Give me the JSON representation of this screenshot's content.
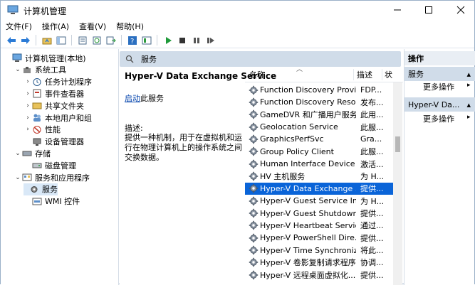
{
  "window": {
    "title": "计算机管理"
  },
  "menu": [
    "文件(F)",
    "操作(A)",
    "查看(V)",
    "帮助(H)"
  ],
  "tree": [
    {
      "label": "计算机管理(本地)",
      "level": 0,
      "icon": "computer-icon",
      "twisty": ""
    },
    {
      "label": "系统工具",
      "level": 1,
      "icon": "tools-icon",
      "twisty": "⌄"
    },
    {
      "label": "任务计划程序",
      "level": 2,
      "icon": "clock-icon",
      "twisty": "›"
    },
    {
      "label": "事件查看器",
      "level": 2,
      "icon": "event-viewer-icon",
      "twisty": "›"
    },
    {
      "label": "共享文件夹",
      "level": 2,
      "icon": "shared-folder-icon",
      "twisty": "›"
    },
    {
      "label": "本地用户和组",
      "level": 2,
      "icon": "users-icon",
      "twisty": "›"
    },
    {
      "label": "性能",
      "level": 2,
      "icon": "performance-icon",
      "twisty": "›"
    },
    {
      "label": "设备管理器",
      "level": 2,
      "icon": "device-manager-icon",
      "twisty": ""
    },
    {
      "label": "存储",
      "level": 1,
      "icon": "storage-icon",
      "twisty": "⌄"
    },
    {
      "label": "磁盘管理",
      "level": 2,
      "icon": "disk-icon",
      "twisty": ""
    },
    {
      "label": "服务和应用程序",
      "level": 1,
      "icon": "apps-icon",
      "twisty": "⌄"
    },
    {
      "label": "服务",
      "level": 2,
      "icon": "services-icon",
      "twisty": "",
      "selected": true
    },
    {
      "label": "WMI 控件",
      "level": 2,
      "icon": "wmi-icon",
      "twisty": ""
    }
  ],
  "middle": {
    "header": "服务",
    "selected_title": "Hyper-V Data Exchange Service",
    "start_link": "启动",
    "start_suffix": "此服务",
    "desc_label": "描述:",
    "desc_text": "提供一种机制，用于在虚拟机和运行在物理计算机上的操作系统之间交换数据。"
  },
  "list": {
    "col_name": "名称",
    "col_desc": "描述",
    "col_status": "状",
    "rows": [
      {
        "name": "Function Discovery Provi...",
        "desc": "FDP..."
      },
      {
        "name": "Function Discovery Reso...",
        "desc": "发布..."
      },
      {
        "name": "GameDVR 和广播用户服务...",
        "desc": "此用..."
      },
      {
        "name": "Geolocation Service",
        "desc": "此服..."
      },
      {
        "name": "GraphicsPerfSvc",
        "desc": "Gra..."
      },
      {
        "name": "Group Policy Client",
        "desc": "此服..."
      },
      {
        "name": "Human Interface Device ...",
        "desc": "激活..."
      },
      {
        "name": "HV 主机服务",
        "desc": "为 H..."
      },
      {
        "name": "Hyper-V Data Exchange ...",
        "desc": "提供...",
        "selected": true
      },
      {
        "name": "Hyper-V Guest Service In...",
        "desc": "为 H..."
      },
      {
        "name": "Hyper-V Guest Shutdown...",
        "desc": "提供..."
      },
      {
        "name": "Hyper-V Heartbeat Service",
        "desc": "通过..."
      },
      {
        "name": "Hyper-V PowerShell Dire...",
        "desc": "提供..."
      },
      {
        "name": "Hyper-V Time Synchroniz...",
        "desc": "将此..."
      },
      {
        "name": "Hyper-V 卷影复制请求程序",
        "desc": "协调..."
      },
      {
        "name": "Hyper-V 远程桌面虚拟化...",
        "desc": "提供..."
      }
    ]
  },
  "actions": {
    "title": "操作",
    "section1": "服务",
    "more1": "更多操作",
    "section2": "Hyper-V Da...",
    "more2": "更多操作"
  }
}
